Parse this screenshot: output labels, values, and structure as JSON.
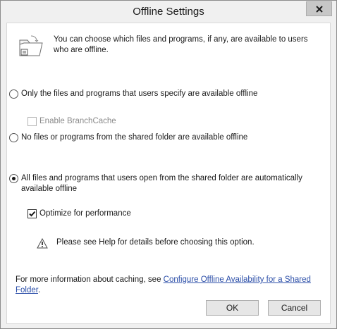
{
  "window": {
    "title": "Offline Settings"
  },
  "icons": {
    "close": "close-icon",
    "folder": "offline-folder-icon",
    "warning": "warning-icon"
  },
  "info": {
    "text": "You can choose which files and programs, if any, are available to users who are offline."
  },
  "options": {
    "specified": {
      "label": "Only the files and programs that users specify are available offline",
      "checked": false
    },
    "branchcache": {
      "label": "Enable BranchCache",
      "checked": false,
      "enabled": false
    },
    "none": {
      "label": "No files or programs from the shared folder are available offline",
      "checked": false
    },
    "all": {
      "label": "All files and programs that users open from the shared folder are automatically available offline",
      "checked": true
    },
    "optimize": {
      "label": "Optimize for performance",
      "checked": true
    }
  },
  "warning": {
    "text": "Please see Help for details before choosing this option."
  },
  "footer": {
    "text": "For more information about caching, see ",
    "link": "Configure Offline Availability for a Shared Folder",
    "suffix": "."
  },
  "buttons": {
    "ok": "OK",
    "cancel": "Cancel"
  },
  "colors": {
    "link": "#2b4ea8",
    "window_bg": "#f0f0f0",
    "panel_bg": "#ffffff"
  }
}
